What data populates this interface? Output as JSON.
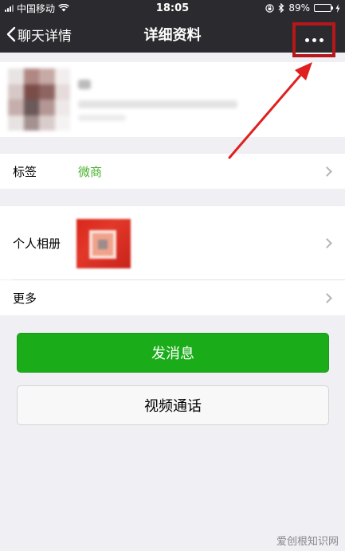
{
  "status_bar": {
    "carrier": "中国移动",
    "time": "18:05",
    "battery_text": "89%",
    "battery_level": 0.89
  },
  "nav": {
    "back_label": "聊天详情",
    "title": "详细资料",
    "more_icon": "more-dots-icon"
  },
  "rows": {
    "tags_label": "标签",
    "tags_value": "微商",
    "album_label": "个人相册",
    "more_label": "更多"
  },
  "buttons": {
    "send_message": "发消息",
    "video_call": "视频通话"
  },
  "watermark": "爱创根知识网",
  "colors": {
    "nav_background": "#2b2b2f",
    "accent_green": "#1aad19",
    "tag_green": "#4cb330",
    "annotation_red": "#e02020"
  }
}
